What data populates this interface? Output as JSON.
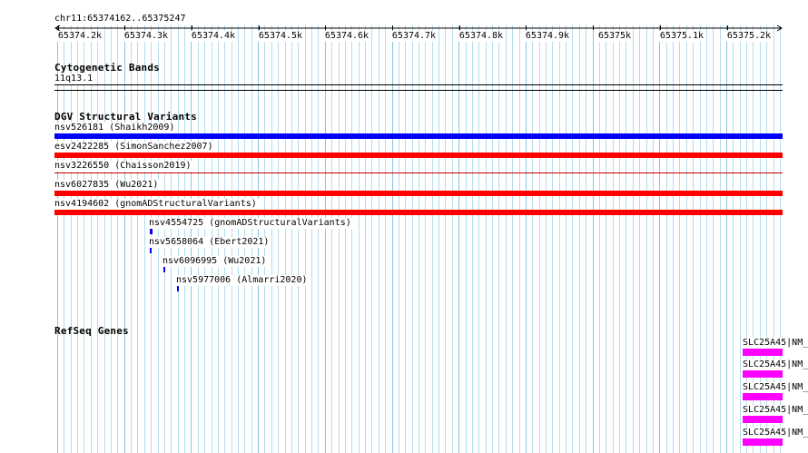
{
  "ruler": {
    "location": "chr11:65374162..65375247",
    "ticks": [
      "65374.2k",
      "65374.3k",
      "65374.4k",
      "65374.5k",
      "65374.6k",
      "65374.7k",
      "65374.8k",
      "65374.9k",
      "65375k",
      "65375.1k",
      "65375.2k"
    ]
  },
  "cytobands": {
    "title": "Cytogenetic Bands",
    "band": "11q13.1"
  },
  "dgv": {
    "title": "DGV Structural Variants",
    "full_width": [
      {
        "label": "nsv526181 (Shaikh2009)",
        "color": "#0000ff",
        "style": "thick"
      },
      {
        "label": "esv2422285 (SimonSanchez2007)",
        "color": "#ff0000",
        "style": "thick"
      },
      {
        "label": "nsv3226550 (Chaisson2019)",
        "color": "#cc0000",
        "style": "thin"
      },
      {
        "label": "nsv6027835 (Wu2021)",
        "color": "#ff0000",
        "style": "thick"
      },
      {
        "label": "nsv4194602 (gnomADStructuralVariants)",
        "color": "#ff0000",
        "style": "thick"
      }
    ],
    "small": [
      {
        "label": "nsv4554725 (gnomADStructuralVariants)",
        "color": "#0000ff"
      },
      {
        "label": "nsv5658064 (Ebert2021)",
        "color": "#0000ff"
      },
      {
        "label": "nsv6096995 (Wu2021)",
        "color": "#0000ff"
      },
      {
        "label": "nsv5977006 (Almarri2020)",
        "color": "#0000ff"
      }
    ]
  },
  "refseq": {
    "title": "RefSeq Genes",
    "color": "#ff00ff",
    "genes": [
      {
        "label": "SLC25A45|NM_"
      },
      {
        "label": "SLC25A45|NM_"
      },
      {
        "label": "SLC25A45|NM_"
      },
      {
        "label": "SLC25A45|NM_"
      },
      {
        "label": "SLC25A45|NM_"
      }
    ]
  }
}
